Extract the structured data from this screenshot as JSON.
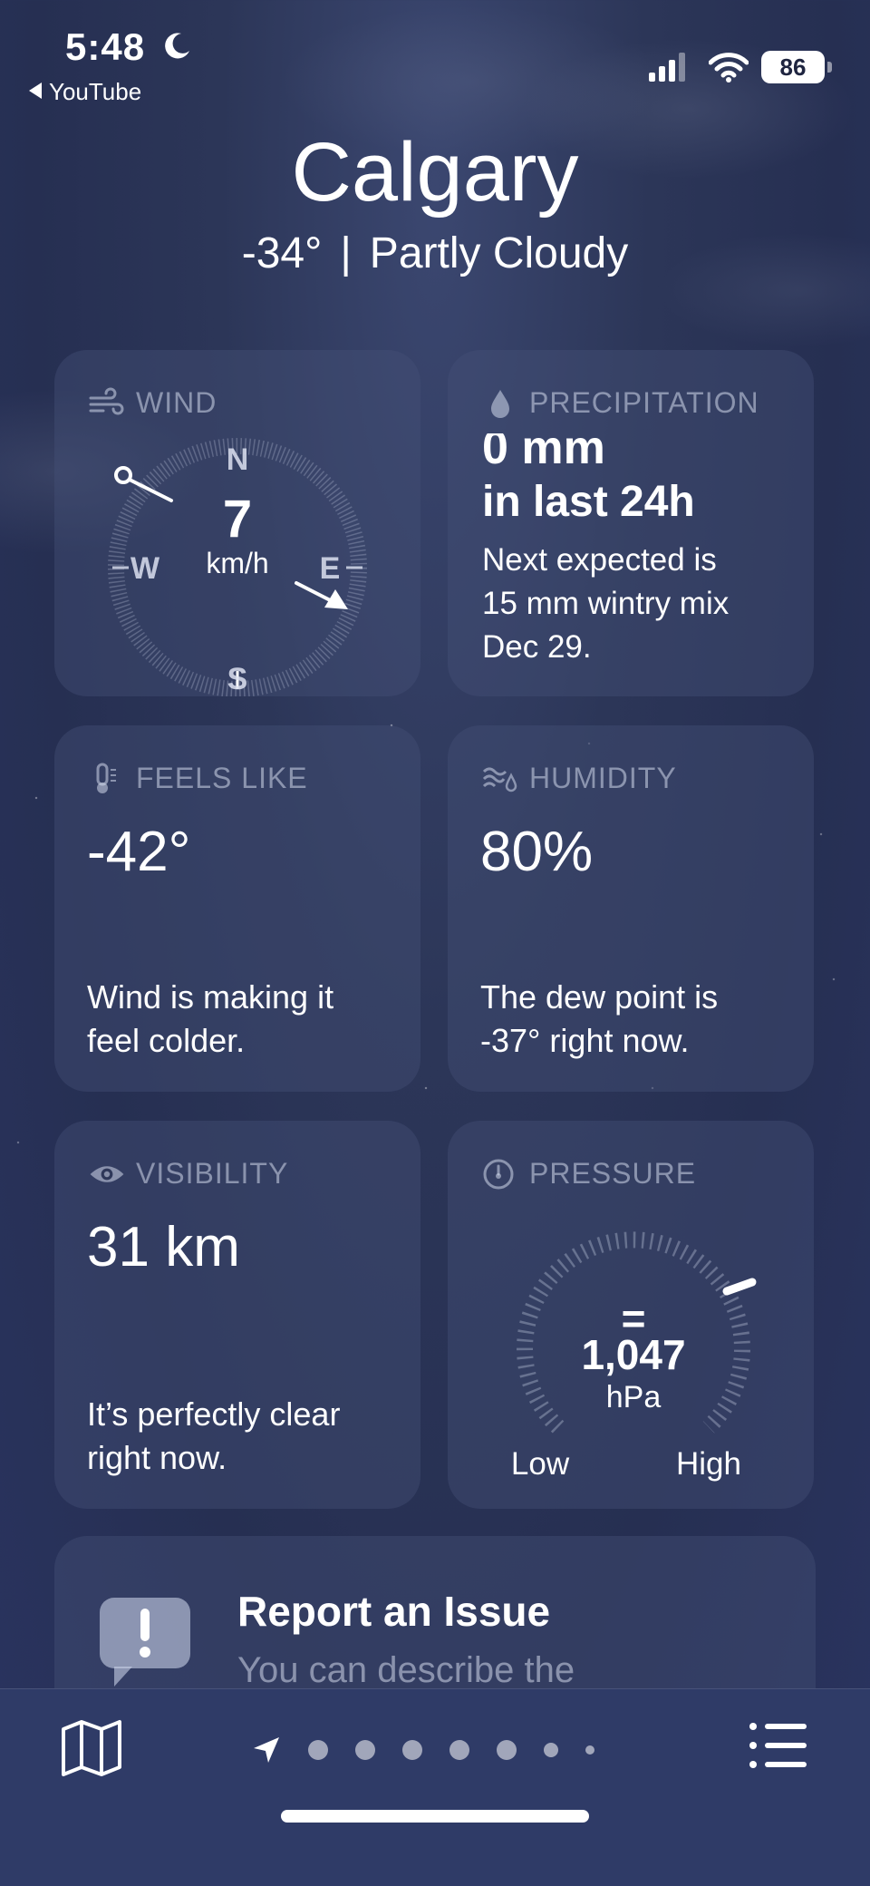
{
  "status_bar": {
    "time": "5:48",
    "back_label": "YouTube",
    "battery": "86"
  },
  "header": {
    "city": "Calgary",
    "temperature": "-34°",
    "separator": "|",
    "condition": "Partly Cloudy"
  },
  "wind": {
    "title": "WIND",
    "speed": "7",
    "unit": "km/h",
    "n": "N",
    "e": "E",
    "s": "S",
    "w": "W"
  },
  "precipitation": {
    "title": "PRECIPITATION",
    "amount": "0 mm",
    "period": "in last 24h",
    "desc_1": "Next expected is",
    "desc_2": "15 mm wintry mix",
    "desc_3": "Dec 29."
  },
  "feels_like": {
    "title": "FEELS LIKE",
    "value": "-42°",
    "desc_1": "Wind is making it",
    "desc_2": "feel colder."
  },
  "humidity": {
    "title": "HUMIDITY",
    "value": "80%",
    "desc_1": "The dew point is",
    "desc_2": "-37° right now."
  },
  "visibility": {
    "title": "VISIBILITY",
    "value": "31 km",
    "desc_1": "It’s perfectly clear",
    "desc_2": "right now."
  },
  "pressure": {
    "title": "PRESSURE",
    "value": "1,047",
    "unit": "hPa",
    "low": "Low",
    "high": "High",
    "trend": "="
  },
  "report": {
    "title": "Report an Issue",
    "subtitle": "You can describe the"
  },
  "bottom_bar": {
    "page_count": 7,
    "active_page": 0
  },
  "icons": [
    "moon-icon",
    "back-arrow-icon",
    "signal-icon",
    "wifi-icon",
    "battery-icon",
    "wind-icon",
    "drop-icon",
    "thermometer-icon",
    "humidity-icon",
    "eye-icon",
    "gauge-icon",
    "exclamation-bubble-icon",
    "map-icon",
    "location-arrow-icon",
    "list-icon"
  ]
}
